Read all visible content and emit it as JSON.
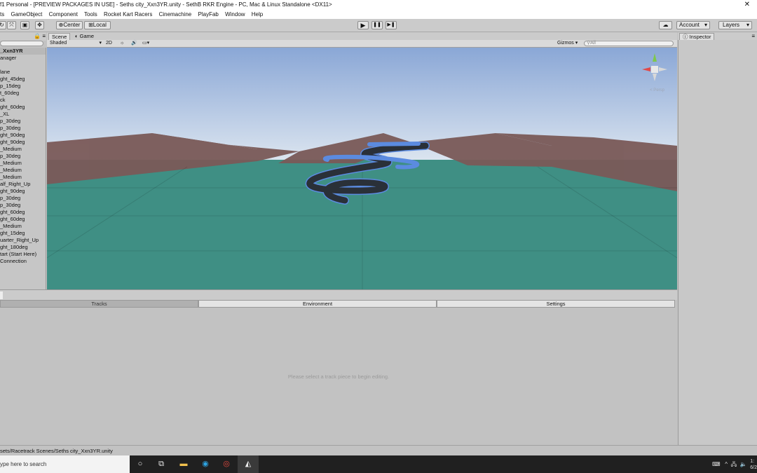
{
  "window": {
    "title": "f1 Personal - [PREVIEW PACKAGES IN USE] - Seths city_Xxn3YR.unity - SethB RKR Engine - PC, Mac & Linux Standalone <DX11>",
    "close_glyph": "✕"
  },
  "menu": [
    "ts",
    "GameObject",
    "Component",
    "Tools",
    "Rocket Kart Racers",
    "Cinemachine",
    "PlayFab",
    "Window",
    "Help"
  ],
  "toolbar": {
    "pivot_label": "Center",
    "space_label": "Local",
    "play_glyph": "▶",
    "pause_glyph": "❚❚",
    "step_glyph": "▶❚",
    "account_label": "Account",
    "layers_label": "Layers",
    "cloud_glyph": "☁"
  },
  "hierarchy": {
    "root": "_Xxn3YR",
    "items": [
      "anager",
      "",
      "lane",
      "ght_45deg",
      "p_15deg",
      "t_60deg",
      "ck",
      "ght_60deg",
      "_XL",
      "p_30deg",
      "p_30deg",
      "ght_90deg",
      "ght_90deg",
      "_Medium",
      "p_30deg",
      "_Medium",
      "_Medium",
      "_Medium",
      "alf_Right_Up",
      "ght_90deg",
      "p_30deg",
      "p_30deg",
      "ght_60deg",
      "ght_60deg",
      "_Medium",
      "ght_15deg",
      "uarter_Right_Up",
      "ght_180deg",
      "tart (Start Here)",
      "Connection"
    ]
  },
  "scene": {
    "tabs": [
      "Scene",
      "Game"
    ],
    "shading": "Shaded",
    "mode_2d": "2D",
    "gizmos_label": "Gizmos",
    "search_placeholder": "All",
    "persp_label": "< Persp"
  },
  "inspector": {
    "tab_label": "Inspector"
  },
  "track_tabs": [
    "Tracks",
    "Environment",
    "Settings"
  ],
  "hint": "Please select a track piece to begin editing.",
  "status": "sets/Racetrack Scenes/Seths city_Xxn3YR.unity",
  "taskbar": {
    "search_placeholder": "ype here to search",
    "clock_time": "1:",
    "clock_date": "6/2"
  },
  "colors": {
    "sky_top": "#8aa7d6",
    "sky_horizon": "#dde6f0",
    "ground": "#3f8f84",
    "walls": "#7a5a58",
    "track": "#2a3038",
    "track_outline": "#5b8be0"
  }
}
